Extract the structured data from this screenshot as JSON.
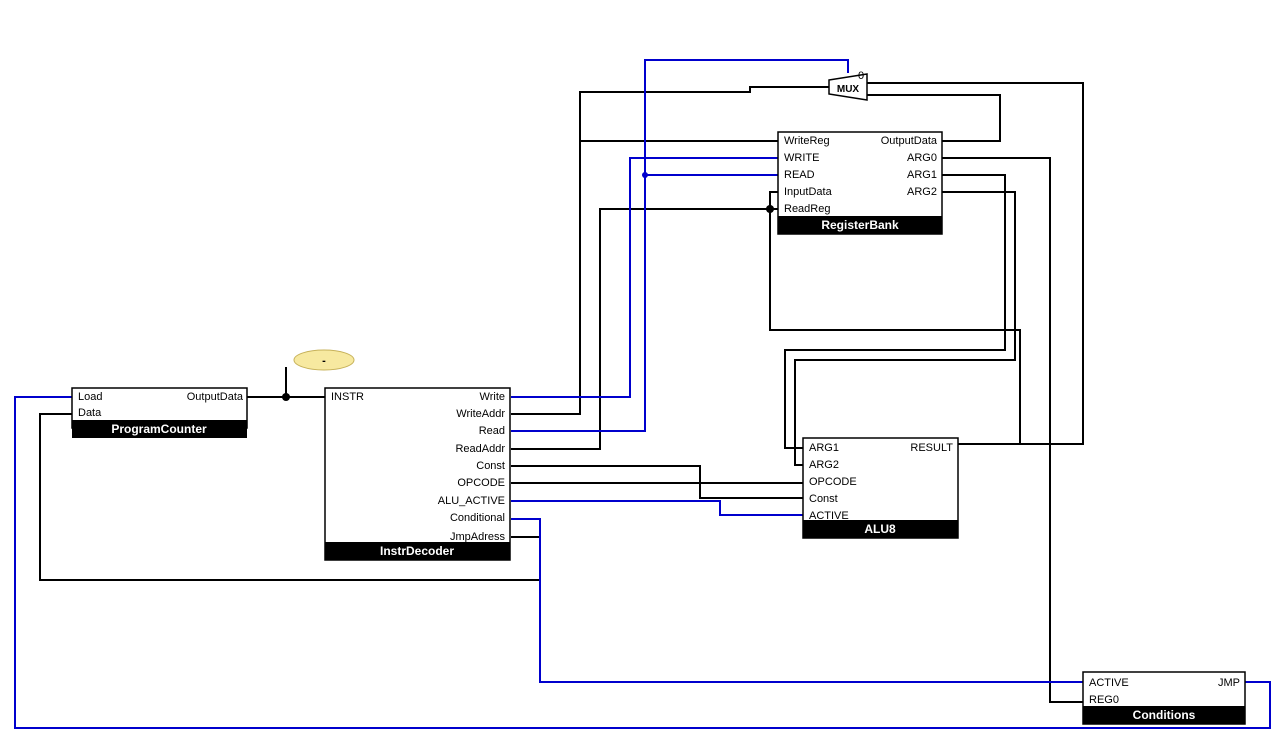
{
  "blocks": {
    "programCounter": {
      "title": "ProgramCounter",
      "ports": {
        "load": "Load",
        "data": "Data",
        "outputData": "OutputData"
      }
    },
    "instrDecoder": {
      "title": "InstrDecoder",
      "ports": {
        "instr": "INSTR",
        "write": "Write",
        "writeAddr": "WriteAddr",
        "read": "Read",
        "readAddr": "ReadAddr",
        "const": "Const",
        "opcode": "OPCODE",
        "aluActive": "ALU_ACTIVE",
        "conditional": "Conditional",
        "jmpAdress": "JmpAdress"
      }
    },
    "registerBank": {
      "title": "RegisterBank",
      "ports": {
        "writeReg": "WriteReg",
        "write": "WRITE",
        "read": "READ",
        "inputData": "InputData",
        "readReg": "ReadReg",
        "outputData": "OutputData",
        "arg0": "ARG0",
        "arg1": "ARG1",
        "arg2": "ARG2"
      }
    },
    "alu8": {
      "title": "ALU8",
      "ports": {
        "arg1": "ARG1",
        "arg2": "ARG2",
        "opcode": "OPCODE",
        "const": "Const",
        "active": "ACTIVE",
        "result": "RESULT"
      }
    },
    "conditions": {
      "title": "Conditions",
      "ports": {
        "active": "ACTIVE",
        "reg0": "REG0",
        "jmp": "JMP"
      }
    }
  },
  "mux": {
    "label": "MUX",
    "index": "0"
  },
  "annotation": {
    "label": "-"
  }
}
